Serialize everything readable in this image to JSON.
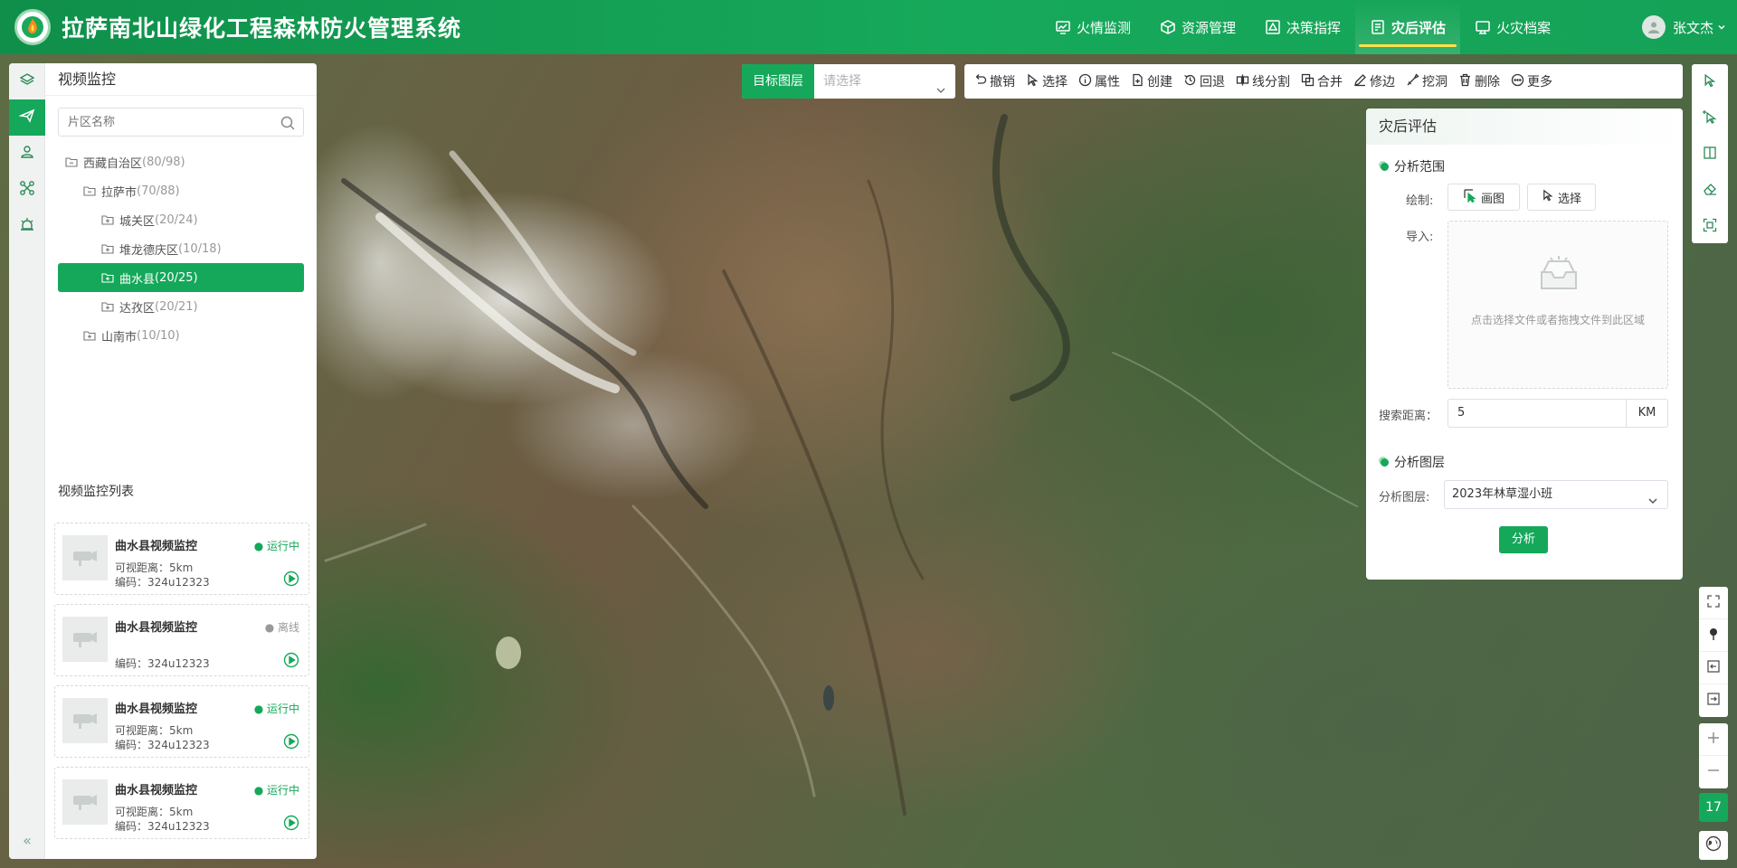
{
  "header": {
    "title": "拉萨南北山绿化工程森林防火管理系统",
    "nav": [
      {
        "label": "火情监测"
      },
      {
        "label": "资源管理"
      },
      {
        "label": "决策指挥"
      },
      {
        "label": "灾后评估",
        "active": true
      },
      {
        "label": "火灾档案"
      }
    ],
    "user": "张文杰",
    "accent": "#15a85a"
  },
  "left": {
    "title": "视频监控",
    "search_placeholder": "片区名称",
    "tree": [
      {
        "label": "西藏自治区",
        "count": "(80/98)",
        "level": 0
      },
      {
        "label": "拉萨市",
        "count": "(70/88)",
        "level": 1
      },
      {
        "label": "城关区",
        "count": "(20/24)",
        "level": 2
      },
      {
        "label": "堆龙德庆区",
        "count": "(10/18)",
        "level": 2
      },
      {
        "label": "曲水县",
        "count": "(20/25)",
        "level": 2,
        "selected": true
      },
      {
        "label": "达孜区",
        "count": "(20/21)",
        "level": 2
      },
      {
        "label": "山南市",
        "count": "(10/10)",
        "level": 1
      }
    ],
    "list_title": "视频监控列表",
    "cards": [
      {
        "name": "曲水县视频监控",
        "status": "运行中",
        "online": true,
        "range": "可视距离：5km",
        "code": "编码：324u12323"
      },
      {
        "name": "曲水县视频监控",
        "status": "离线",
        "online": false,
        "range": "",
        "code": "编码：324u12323"
      },
      {
        "name": "曲水县视频监控",
        "status": "运行中",
        "online": true,
        "range": "可视距离：5km",
        "code": "编码：324u12323"
      },
      {
        "name": "曲水县视频监控",
        "status": "运行中",
        "online": true,
        "range": "可视距离：5km",
        "code": "编码：324u12323"
      }
    ],
    "collapse": "«"
  },
  "layer": {
    "label": "目标图层",
    "placeholder": "请选择"
  },
  "toolbar": [
    "撤销",
    "选择",
    "属性",
    "创建",
    "回退",
    "线分割",
    "合并",
    "修边",
    "挖洞",
    "删除",
    "更多"
  ],
  "panel": {
    "title": "灾后评估",
    "section1": "分析范围",
    "draw_label": "绘制:",
    "draw_btn": "画图",
    "select_btn": "选择",
    "import_label": "导入:",
    "upload_text": "点击选择文件或者拖拽文件到此区域",
    "distance_label": "搜索距离：",
    "distance_value": "5",
    "distance_unit": "KM",
    "section2": "分析图层",
    "layer_label": "分析图层:",
    "layer_value": "2023年林草湿小班",
    "analyze_btn": "分析"
  },
  "map": {
    "zoom": "17"
  }
}
